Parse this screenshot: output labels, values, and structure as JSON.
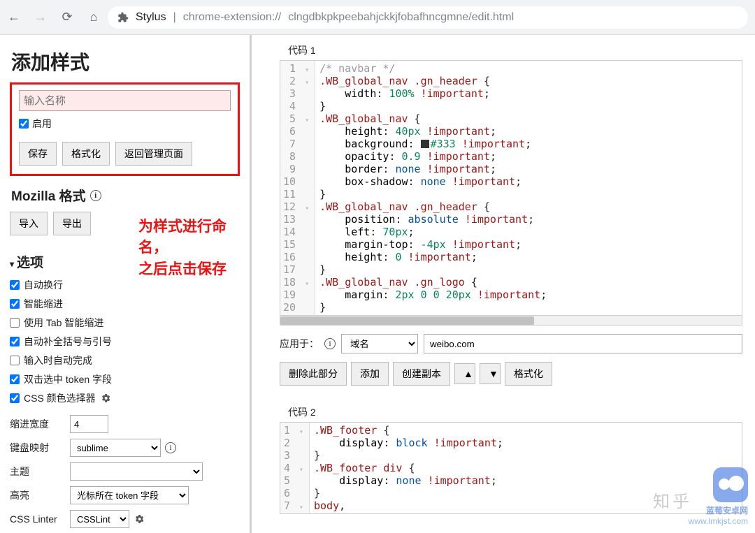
{
  "browser": {
    "title_app": "Stylus",
    "title_sep": " | ",
    "url_prefix": "chrome-extension://",
    "url_path": "clngdbkpkpeebahjckkjfobafhncgmne/edit.html"
  },
  "sidebar": {
    "heading": "添加样式",
    "name_placeholder": "输入名称",
    "enable_label": "启用",
    "buttons": {
      "save": "保存",
      "format": "格式化",
      "back": "返回管理页面"
    },
    "mozilla_heading": "Mozilla 格式",
    "import_btn": "导入",
    "export_btn": "导出",
    "annotation_line1": "为样式进行命名，",
    "annotation_line2": "之后点击保存",
    "options_heading": "选项",
    "options": [
      {
        "label": "自动换行",
        "checked": true
      },
      {
        "label": "智能缩进",
        "checked": true
      },
      {
        "label": "使用 Tab 智能缩进",
        "checked": false
      },
      {
        "label": "自动补全括号与引号",
        "checked": true
      },
      {
        "label": "输入时自动完成",
        "checked": false
      },
      {
        "label": "双击选中 token 字段",
        "checked": true
      },
      {
        "label": "CSS 颜色选择器",
        "checked": true,
        "gear": true
      }
    ],
    "settings": {
      "indent_label": "缩进宽度",
      "indent_value": "4",
      "keymap_label": "键盘映射",
      "keymap_value": "sublime",
      "theme_label": "主题",
      "theme_value": "",
      "highlight_label": "高亮",
      "highlight_value": "光标所在 token 字段",
      "linter_label": "CSS Linter",
      "linter_value": "CSSLint"
    }
  },
  "editor1": {
    "label": "代码 1",
    "lines": [
      {
        "n": 1,
        "fold": "▾",
        "html": "<span class='c-cmt'>/* navbar */</span>"
      },
      {
        "n": 2,
        "fold": "▾",
        "html": "<span class='c-sel'>.WB_global_nav .gn_header</span> {"
      },
      {
        "n": 3,
        "fold": "",
        "html": "    <span class='c-prop'>width</span>: <span class='c-num'>100%</span> <span class='c-imp'>!important</span>;"
      },
      {
        "n": 4,
        "fold": "",
        "html": "}"
      },
      {
        "n": 5,
        "fold": "▾",
        "html": "<span class='c-sel'>.WB_global_nav</span> {"
      },
      {
        "n": 6,
        "fold": "",
        "html": "    <span class='c-prop'>height</span>: <span class='c-num'>40px</span> <span class='c-imp'>!important</span>;"
      },
      {
        "n": 7,
        "fold": "",
        "html": "    <span class='c-prop'>background</span>: <span class='c-swatch'></span><span class='c-num'>#333</span> <span class='c-imp'>!important</span>;"
      },
      {
        "n": 8,
        "fold": "",
        "html": "    <span class='c-prop'>opacity</span>: <span class='c-num'>0.9</span> <span class='c-imp'>!important</span>;"
      },
      {
        "n": 9,
        "fold": "",
        "html": "    <span class='c-prop'>border</span>: <span class='c-val'>none</span> <span class='c-imp'>!important</span>;"
      },
      {
        "n": 10,
        "fold": "",
        "html": "    <span class='c-prop'>box-shadow</span>: <span class='c-val'>none</span> <span class='c-imp'>!important</span>;"
      },
      {
        "n": 11,
        "fold": "",
        "html": "}"
      },
      {
        "n": 12,
        "fold": "▾",
        "html": "<span class='c-sel'>.WB_global_nav .gn_header</span> {"
      },
      {
        "n": 13,
        "fold": "",
        "html": "    <span class='c-prop'>position</span>: <span class='c-val'>absolute</span> <span class='c-imp'>!important</span>;"
      },
      {
        "n": 14,
        "fold": "",
        "html": "    <span class='c-prop'>left</span>: <span class='c-num'>70px</span>;"
      },
      {
        "n": 15,
        "fold": "",
        "html": "    <span class='c-prop'>margin-top</span>: <span class='c-num'>-4px</span> <span class='c-imp'>!important</span>;"
      },
      {
        "n": 16,
        "fold": "",
        "html": "    <span class='c-prop'>height</span>: <span class='c-num'>0</span> <span class='c-imp'>!important</span>;"
      },
      {
        "n": 17,
        "fold": "",
        "html": "}"
      },
      {
        "n": 18,
        "fold": "▾",
        "html": "<span class='c-sel'>.WB_global_nav .gn_logo</span> {"
      },
      {
        "n": 19,
        "fold": "",
        "html": "    <span class='c-prop'>margin</span>: <span class='c-num'>2px 0 0 20px</span> <span class='c-imp'>!important</span>;"
      },
      {
        "n": 20,
        "fold": "",
        "html": "}"
      }
    ]
  },
  "apply": {
    "label": "应用于：",
    "scope": "域名",
    "value": "weibo.com"
  },
  "actions": {
    "delete": "删除此部分",
    "add": "添加",
    "clone": "创建副本",
    "format": "格式化"
  },
  "editor2": {
    "label": "代码 2",
    "lines": [
      {
        "n": 1,
        "fold": "▾",
        "html": "<span class='c-sel'>.WB_footer</span> {"
      },
      {
        "n": 2,
        "fold": "",
        "html": "    <span class='c-prop'>display</span>: <span class='c-val'>block</span> <span class='c-imp'>!important</span>;"
      },
      {
        "n": 3,
        "fold": "",
        "html": "}"
      },
      {
        "n": 4,
        "fold": "▾",
        "html": "<span class='c-sel'>.WB_footer div</span> {"
      },
      {
        "n": 5,
        "fold": "",
        "html": "    <span class='c-prop'>display</span>: <span class='c-val'>none</span> <span class='c-imp'>!important</span>;"
      },
      {
        "n": 6,
        "fold": "",
        "html": "}"
      },
      {
        "n": 7,
        "fold": "▾",
        "html": "<span class='c-sel'>body</span>,"
      }
    ]
  },
  "watermark": {
    "brand": "蓝莓安卓网",
    "url": "www.lmkjst.com",
    "faint": "知乎"
  }
}
